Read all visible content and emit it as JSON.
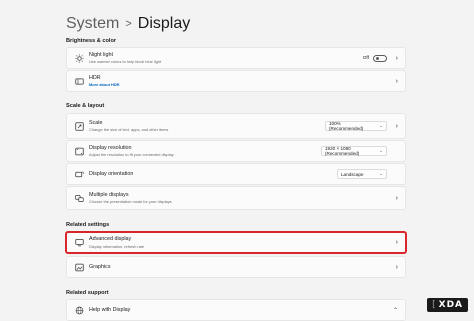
{
  "breadcrumb": {
    "parent": "System",
    "separator": ">",
    "current": "Display"
  },
  "sections": {
    "brightness": "Brightness & color",
    "scale_layout": "Scale & layout",
    "related_settings": "Related settings",
    "related_support": "Related support"
  },
  "items": {
    "night_light": {
      "title": "Night light",
      "subtitle": "Use warmer colors to help block blue light",
      "toggle_state": "Off",
      "icon": "sun-icon"
    },
    "hdr": {
      "title": "HDR",
      "subtitle": "More about HDR",
      "icon": "hdr-icon"
    },
    "scale": {
      "title": "Scale",
      "subtitle": "Change the size of text, apps, and other items",
      "value": "100% (Recommended)",
      "icon": "scale-icon"
    },
    "resolution": {
      "title": "Display resolution",
      "subtitle": "Adjust the resolution to fit your connected display",
      "value": "1920 × 1080 (Recommended)",
      "icon": "resolution-icon"
    },
    "orientation": {
      "title": "Display orientation",
      "value": "Landscape",
      "icon": "orientation-icon"
    },
    "multiple_displays": {
      "title": "Multiple displays",
      "subtitle": "Choose the presentation mode for your displays",
      "icon": "multiple-displays-icon"
    },
    "advanced_display": {
      "title": "Advanced display",
      "subtitle": "Display information, refresh rate",
      "icon": "monitor-icon"
    },
    "graphics": {
      "title": "Graphics",
      "icon": "graphics-icon"
    },
    "help_display": {
      "title": "Help with Display",
      "icon": "globe-icon"
    }
  },
  "watermark": "XDA",
  "colors": {
    "highlight": "#d9262c",
    "link": "#0067c0",
    "background": "#f3f3f3"
  }
}
